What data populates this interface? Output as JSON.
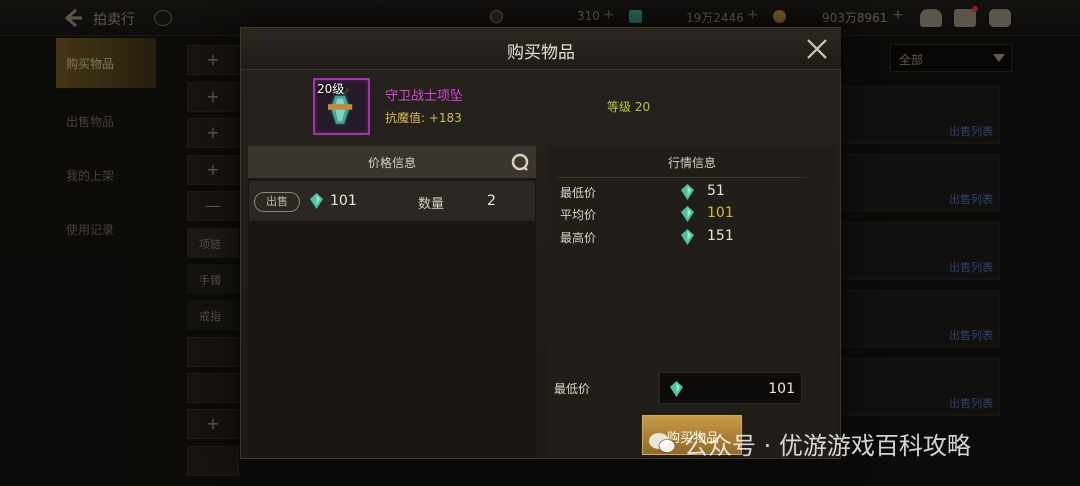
{
  "topbar": {
    "title": "拍卖行",
    "currency_1": "310",
    "currency_2": "19万2446",
    "currency_3": "903万8961"
  },
  "sidebar": {
    "items": [
      {
        "label": "购买物品"
      },
      {
        "label": "出售物品"
      },
      {
        "label": "我的上架"
      },
      {
        "label": "使用记录"
      }
    ]
  },
  "categories": {
    "sub_items": [
      {
        "label": "项链"
      },
      {
        "label": "手镯"
      },
      {
        "label": "戒指"
      }
    ]
  },
  "right_panel": {
    "filter": "全部",
    "sale_link": "出售列表"
  },
  "modal": {
    "title": "购买物品",
    "item": {
      "level": "20级",
      "name": "守卫战士项坠",
      "stat": "抗魔值: +183",
      "grade": "等级 20"
    },
    "price_info": {
      "title": "价格信息",
      "sell_tag": "出售",
      "price": "101",
      "qty_label": "数量",
      "qty": "2"
    },
    "market_info": {
      "title": "行情信息",
      "rows": [
        {
          "label": "最低价",
          "value": "51"
        },
        {
          "label": "平均价",
          "value": "101"
        },
        {
          "label": "最高价",
          "value": "151"
        }
      ]
    },
    "min_price_label": "最低价",
    "min_price_value": "101",
    "buy_button": "购买物品"
  },
  "watermark": "公众号 · 优游游戏百科攻略",
  "colors": {
    "gem": "#4fc0a0",
    "item_name": "#d645d6",
    "stat": "#d9b957",
    "grade": "#b6c93c",
    "button": "#c89b48"
  }
}
